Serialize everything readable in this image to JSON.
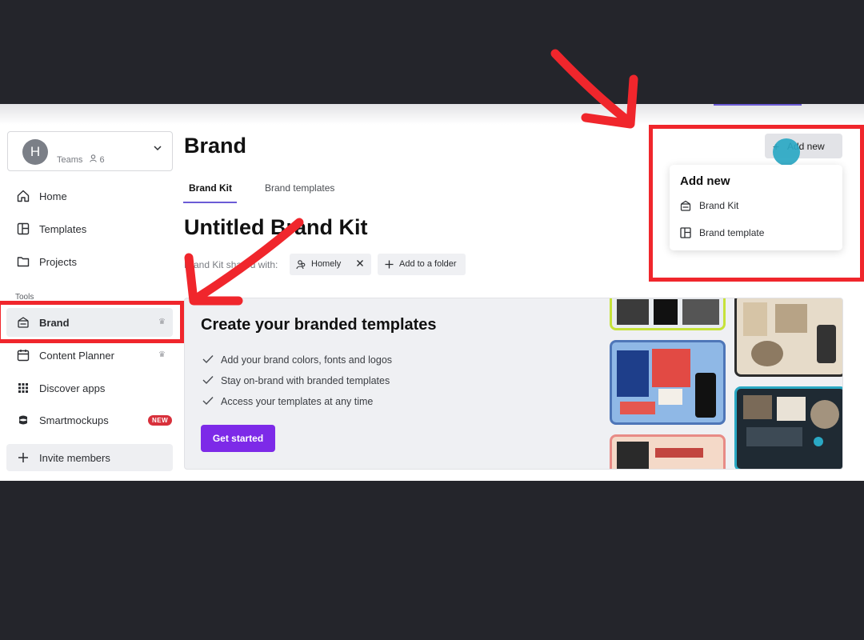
{
  "sidebar": {
    "team": {
      "avatar_letter": "H",
      "label": "Teams",
      "member_count": "6"
    },
    "items": [
      {
        "label": "Home"
      },
      {
        "label": "Templates"
      },
      {
        "label": "Projects"
      }
    ],
    "tools_heading": "Tools",
    "tools": [
      {
        "label": "Brand",
        "crown": "♛"
      },
      {
        "label": "Content Planner",
        "crown": "♛"
      },
      {
        "label": "Discover apps"
      },
      {
        "label": "Smartmockups",
        "badge": "NEW"
      }
    ],
    "invite_label": "Invite members"
  },
  "main": {
    "title": "Brand",
    "tabs": [
      {
        "label": "Brand Kit"
      },
      {
        "label": "Brand templates"
      }
    ],
    "kit_title": "Untitled Brand Kit",
    "shared_label": "Brand Kit shared with:",
    "shared_chip": "Homely",
    "folder_chip": "Add to a folder"
  },
  "banner": {
    "title": "Create your branded templates",
    "benefits": [
      "Add your brand colors, fonts and logos",
      "Stay on-brand with branded templates",
      "Access your templates at any time"
    ],
    "cta": "Get started"
  },
  "add_new": {
    "button_label": "Add new",
    "menu_title": "Add new",
    "menu_items": [
      {
        "label": "Brand Kit"
      },
      {
        "label": "Brand template"
      }
    ]
  },
  "colors": {
    "accent_purple": "#7d2ae8",
    "annotation_red": "#f0262c",
    "badge_red": "#d8303b",
    "cursor_teal": "#2aa8c4"
  }
}
